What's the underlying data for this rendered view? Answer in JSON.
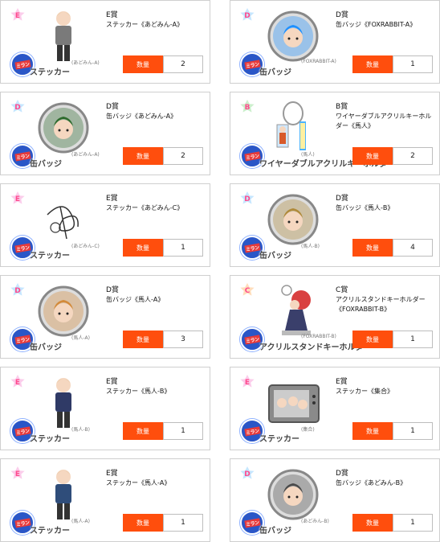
{
  "items": [
    {
      "badge": "E",
      "badge_color": "#f36fc6",
      "prize": "E賞",
      "name": "ステッカー《あどみん-A》",
      "type_label": "ステッカー",
      "small_label": "(あどみん-A)",
      "button_label": "数量",
      "quantity": "2",
      "art": "sticker-figure-icon",
      "art_color": "#7a7a7a"
    },
    {
      "badge": "D",
      "badge_color": "#5db6ff",
      "prize": "D賞",
      "name": "缶バッジ《FOXRABBIT-A》",
      "type_label": "缶バッジ",
      "small_label": "(FOXRABBIT-A)",
      "button_label": "数量",
      "quantity": "1",
      "art": "badge-portrait-icon",
      "art_color": "#1e90ff"
    },
    {
      "badge": "D",
      "badge_color": "#5db6ff",
      "prize": "D賞",
      "name": "缶バッジ《あどみん-A》",
      "type_label": "缶バッジ",
      "small_label": "(あどみん-A)",
      "button_label": "数量",
      "quantity": "2",
      "art": "badge-portrait-icon",
      "art_color": "#2d6b2d"
    },
    {
      "badge": "B",
      "badge_color": "#6dd26d",
      "prize": "B賞",
      "name": "ワイヤーダブルアクリルキーホルダー《馬人》",
      "type_label": "ワイヤーダブルアクリルキーホルダー",
      "small_label": "(馬人)",
      "button_label": "数量",
      "quantity": "2",
      "art": "keychain-icon",
      "art_color": "#4bb3ff"
    },
    {
      "badge": "E",
      "badge_color": "#f36fc6",
      "prize": "E賞",
      "name": "ステッカー《あどみん-C》",
      "type_label": "ステッカー",
      "small_label": "(あどみん-C)",
      "button_label": "数量",
      "quantity": "1",
      "art": "signature-icon",
      "art_color": "#333333"
    },
    {
      "badge": "D",
      "badge_color": "#5db6ff",
      "prize": "D賞",
      "name": "缶バッジ《馬人-B》",
      "type_label": "缶バッジ",
      "small_label": "(馬人-B)",
      "button_label": "数量",
      "quantity": "4",
      "art": "badge-portrait-icon",
      "art_color": "#b08a3a"
    },
    {
      "badge": "D",
      "badge_color": "#5db6ff",
      "prize": "D賞",
      "name": "缶バッジ《馬人-A》",
      "type_label": "缶バッジ",
      "small_label": "(馬人-A)",
      "button_label": "数量",
      "quantity": "3",
      "art": "badge-portrait-icon",
      "art_color": "#d38a3a"
    },
    {
      "badge": "C",
      "badge_color": "#ff9d3c",
      "prize": "C賞",
      "name": "アクリルスタンドキーホルダー《FOXRABBIT-B》",
      "type_label": "アクリルスタンドキーホルダー",
      "small_label": "(FOXRABBIT-B)",
      "button_label": "数量",
      "quantity": "1",
      "art": "acrylic-stand-icon",
      "art_color": "#3a3f6b"
    },
    {
      "badge": "E",
      "badge_color": "#f36fc6",
      "prize": "E賞",
      "name": "ステッカー《馬人-B》",
      "type_label": "ステッカー",
      "small_label": "(馬人-B)",
      "button_label": "数量",
      "quantity": "1",
      "art": "sticker-figure-icon",
      "art_color": "#2f3a66"
    },
    {
      "badge": "E",
      "badge_color": "#f36fc6",
      "prize": "E賞",
      "name": "ステッカー《集合》",
      "type_label": "ステッカー",
      "small_label": "(集合)",
      "button_label": "数量",
      "quantity": "1",
      "art": "tv-icon",
      "art_color": "#6b6b6b"
    },
    {
      "badge": "E",
      "badge_color": "#f36fc6",
      "prize": "E賞",
      "name": "ステッカー《馬人-A》",
      "type_label": "ステッカー",
      "small_label": "(馬人-A)",
      "button_label": "数量",
      "quantity": "1",
      "art": "sticker-figure-icon",
      "art_color": "#2f4d7a"
    },
    {
      "badge": "D",
      "badge_color": "#5db6ff",
      "prize": "D賞",
      "name": "缶バッジ《あどみん-B》",
      "type_label": "缶バッジ",
      "small_label": "(あどみん-B)",
      "button_label": "数量",
      "quantity": "1",
      "art": "badge-portrait-icon",
      "art_color": "#4a4a4a"
    }
  ],
  "brand": {
    "logo_text": "ミラン",
    "accent": "#ff4e0d",
    "border": "#cfcfcf"
  }
}
